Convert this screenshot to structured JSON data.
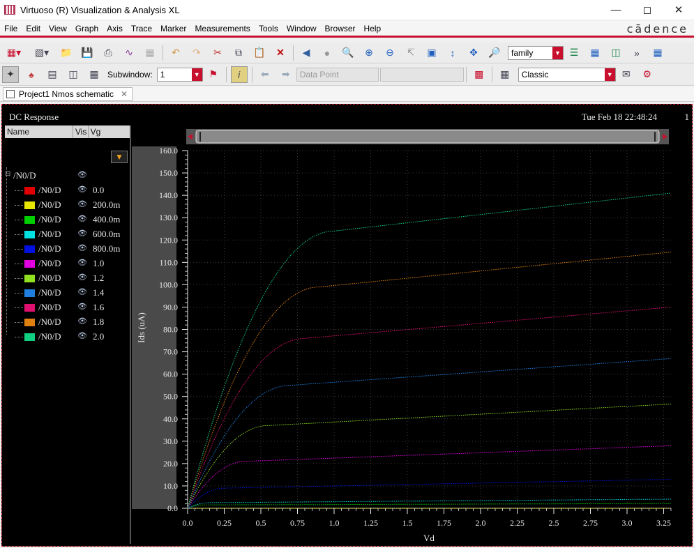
{
  "window": {
    "title": "Virtuoso (R) Visualization & Analysis XL"
  },
  "menu": [
    "File",
    "Edit",
    "View",
    "Graph",
    "Axis",
    "Trace",
    "Marker",
    "Measurements",
    "Tools",
    "Window",
    "Browser",
    "Help"
  ],
  "brand": "cādence",
  "toolbar1": {
    "family_combo": "family"
  },
  "toolbar2": {
    "subwindow_label": "Subwindow:",
    "subwindow_value": "1",
    "datapoint_combo": "Data Point",
    "style_combo": "Classic"
  },
  "tab": {
    "label": "Project1 Nmos schematic"
  },
  "plot": {
    "title": "DC Response",
    "timestamp": "Tue Feb 18 22:48:24",
    "subwindow_number": "1"
  },
  "legend": {
    "headers": {
      "name": "Name",
      "vis": "Vis",
      "vg": "Vg"
    },
    "group": "/N0/D",
    "rows": [
      {
        "name": "/N0/D",
        "vg": "0.0",
        "color": "#e00000"
      },
      {
        "name": "/N0/D",
        "vg": "200.0m",
        "color": "#e6e600"
      },
      {
        "name": "/N0/D",
        "vg": "400.0m",
        "color": "#00d000"
      },
      {
        "name": "/N0/D",
        "vg": "600.0m",
        "color": "#00e0e0"
      },
      {
        "name": "/N0/D",
        "vg": "800.0m",
        "color": "#0010e0"
      },
      {
        "name": "/N0/D",
        "vg": "1.0",
        "color": "#e000e0"
      },
      {
        "name": "/N0/D",
        "vg": "1.2",
        "color": "#90e020"
      },
      {
        "name": "/N0/D",
        "vg": "1.4",
        "color": "#1e7fe0"
      },
      {
        "name": "/N0/D",
        "vg": "1.6",
        "color": "#e0106e"
      },
      {
        "name": "/N0/D",
        "vg": "1.8",
        "color": "#e08010"
      },
      {
        "name": "/N0/D",
        "vg": "2.0",
        "color": "#10d080"
      }
    ]
  },
  "chart_data": {
    "type": "line",
    "xlabel": "Vd",
    "ylabel": "Ids (uA)",
    "xlim": [
      0,
      3.3
    ],
    "ylim": [
      0,
      160
    ],
    "x_ticks": [
      "0.0",
      "0.25",
      "0.5",
      "0.75",
      "1.0",
      "1.25",
      "1.5",
      "1.75",
      "2.0",
      "2.25",
      "2.5",
      "2.75",
      "3.0",
      "3.25"
    ],
    "y_ticks": [
      "0.0",
      "10.0",
      "20.0",
      "30.0",
      "40.0",
      "50.0",
      "60.0",
      "70.0",
      "80.0",
      "90.0",
      "100.0",
      "110.0",
      "120.0",
      "130.0",
      "140.0",
      "150.0",
      "160.0"
    ],
    "grid": true,
    "series_params": [
      {
        "vg": "0.0",
        "ids_at_sat_uA": 0.0,
        "vdsat": 0.05,
        "slope_uA_per_V": 0.0
      },
      {
        "vg": "200.0m",
        "ids_at_sat_uA": 0.0,
        "vdsat": 0.05,
        "slope_uA_per_V": 0.0
      },
      {
        "vg": "400.0m",
        "ids_at_sat_uA": 1.5,
        "vdsat": 0.1,
        "slope_uA_per_V": 0.2
      },
      {
        "vg": "600.0m",
        "ids_at_sat_uA": 2.5,
        "vdsat": 0.15,
        "slope_uA_per_V": 0.5
      },
      {
        "vg": "800.0m",
        "ids_at_sat_uA": 9.0,
        "vdsat": 0.25,
        "slope_uA_per_V": 1.3
      },
      {
        "vg": "1.0",
        "ids_at_sat_uA": 21.0,
        "vdsat": 0.4,
        "slope_uA_per_V": 2.4
      },
      {
        "vg": "1.2",
        "ids_at_sat_uA": 37.0,
        "vdsat": 0.55,
        "slope_uA_per_V": 3.5
      },
      {
        "vg": "1.4",
        "ids_at_sat_uA": 55.0,
        "vdsat": 0.7,
        "slope_uA_per_V": 4.6
      },
      {
        "vg": "1.6",
        "ids_at_sat_uA": 76.0,
        "vdsat": 0.8,
        "slope_uA_per_V": 5.6
      },
      {
        "vg": "1.8",
        "ids_at_sat_uA": 99.0,
        "vdsat": 0.9,
        "slope_uA_per_V": 6.5
      },
      {
        "vg": "2.0",
        "ids_at_sat_uA": 124.0,
        "vdsat": 1.0,
        "slope_uA_per_V": 7.4
      }
    ]
  }
}
